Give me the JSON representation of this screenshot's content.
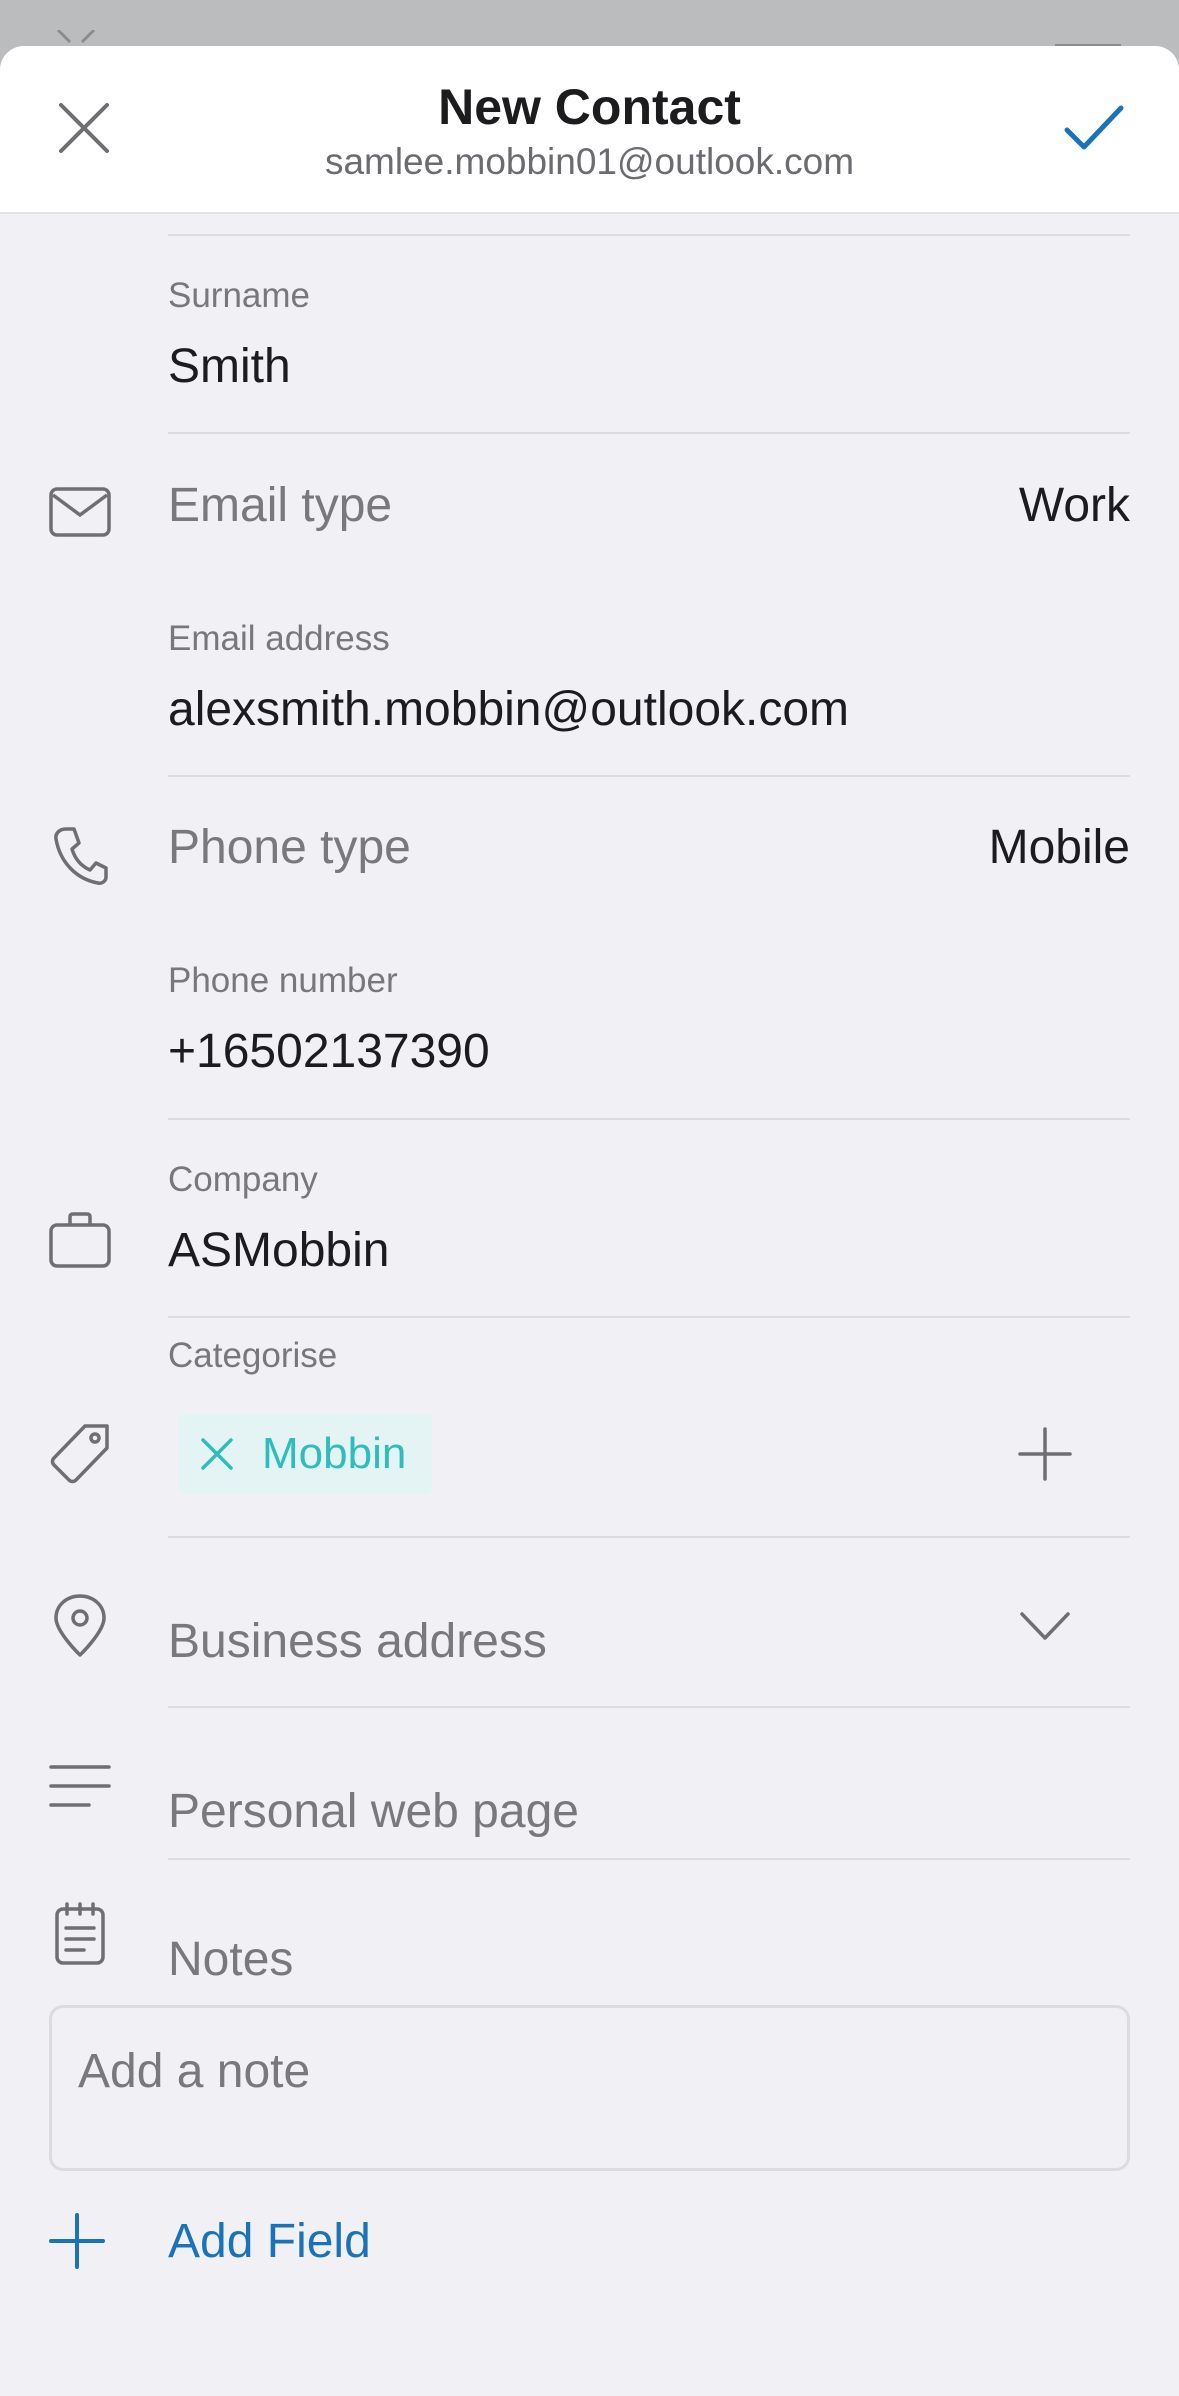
{
  "header": {
    "title": "New Contact",
    "account": "samlee.mobbin01@outlook.com",
    "close_icon": "close-icon",
    "done_icon": "checkmark-icon",
    "accent_color": "#1a73b8"
  },
  "fields": {
    "surname": {
      "label": "Surname",
      "value": "Smith"
    },
    "email_type": {
      "label": "Email type",
      "value": "Work",
      "icon": "envelope-icon"
    },
    "email_address": {
      "label": "Email address",
      "value": "alexsmith.mobbin@outlook.com"
    },
    "phone_type": {
      "label": "Phone type",
      "value": "Mobile",
      "icon": "phone-icon"
    },
    "phone_number": {
      "label": "Phone number",
      "value": "+16502137390"
    },
    "company": {
      "label": "Company",
      "value": "ASMobbin",
      "icon": "briefcase-icon"
    },
    "categorise": {
      "label": "Categorise",
      "icon": "tag-icon",
      "chips": [
        {
          "label": "Mobbin",
          "color": "#2fbcbc"
        }
      ]
    },
    "business_address": {
      "placeholder": "Business address",
      "icon": "location-pin-icon"
    },
    "personal_web_page": {
      "placeholder": "Personal web page",
      "icon": "lines-icon"
    },
    "notes": {
      "placeholder": "Notes",
      "icon": "notes-icon",
      "input_placeholder": "Add a note"
    }
  },
  "add_field": {
    "label": "Add Field",
    "icon": "plus-icon"
  }
}
